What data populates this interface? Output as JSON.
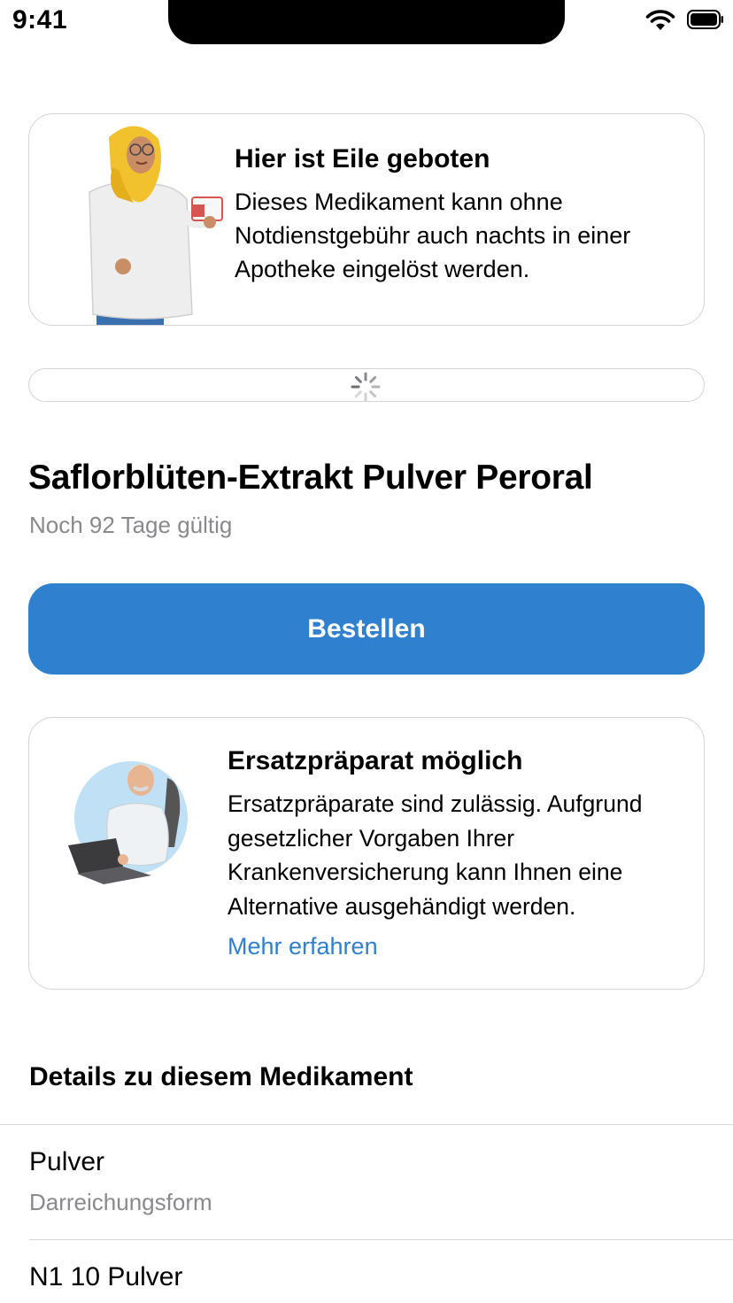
{
  "status_bar": {
    "time": "9:41"
  },
  "hint_card": {
    "title": "Hier ist Eile geboten",
    "text": "Dieses Medikament kann ohne Notdienstgebühr auch nachts in einer Apotheke eingelöst werden."
  },
  "medication": {
    "name": "Saflorblüten-Extrakt Pulver Peroral",
    "validity": "Noch 92 Tage gültig"
  },
  "order_button": {
    "label": "Bestellen"
  },
  "substitution_card": {
    "title": "Ersatzpräparat möglich",
    "text": "Ersatzpräparate sind zulässig. Aufgrund gesetzlicher Vorgaben Ihrer Krankenversicherung kann Ihnen eine Alternative ausgehändigt werden.",
    "link": "Mehr erfahren"
  },
  "details": {
    "heading": "Details zu diesem Medikament",
    "rows": [
      {
        "value": "Pulver",
        "label": "Darreichungsform"
      },
      {
        "value": "N1 10 Pulver"
      }
    ]
  },
  "colors": {
    "accent": "#2f80cf",
    "secondary_text": "#8a8a8e",
    "border": "#d4d4d8"
  }
}
